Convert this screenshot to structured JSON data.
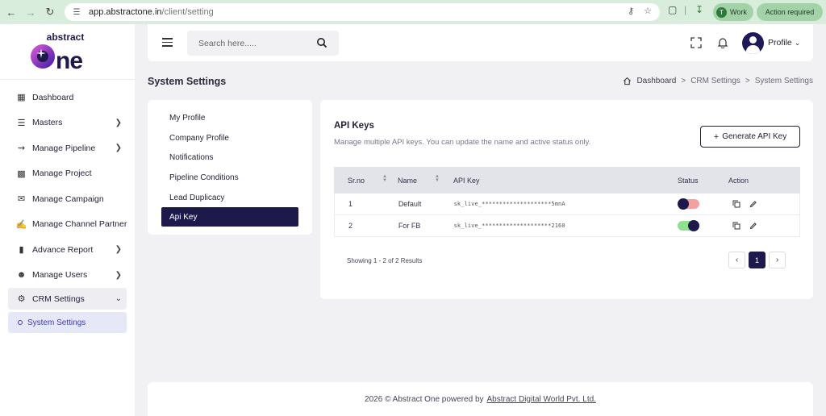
{
  "browser": {
    "url_host": "app.abstractone.in",
    "url_path": "/client/setting",
    "work_label": "Work",
    "work_initial": "T",
    "action_label": "Action required"
  },
  "sidebar": {
    "logo_top": "abstract",
    "logo_main": "One",
    "items": [
      {
        "label": "Dashboard",
        "icon": "dashboard-icon"
      },
      {
        "label": "Masters",
        "icon": "list-icon"
      },
      {
        "label": "Manage Pipeline",
        "icon": "pipeline-icon"
      },
      {
        "label": "Manage Project",
        "icon": "building-icon"
      },
      {
        "label": "Manage Campaign",
        "icon": "megaphone-icon"
      },
      {
        "label": "Manage Channel Partner",
        "icon": "handshake-icon"
      },
      {
        "label": "Advance Report",
        "icon": "bar-chart-icon"
      },
      {
        "label": "Manage Users",
        "icon": "users-icon"
      },
      {
        "label": "CRM Settings",
        "icon": "gear-icon"
      }
    ],
    "sub_active": "System Settings"
  },
  "header": {
    "search_placeholder": "Search here.....",
    "profile_label": "Profile"
  },
  "page": {
    "title": "System Settings",
    "breadcrumb": [
      "Dashboard",
      "CRM Settings",
      "System Settings"
    ],
    "breadcrumb_sep": ">"
  },
  "settings_nav": [
    "My Profile",
    "Company Profile",
    "Notifications",
    "Pipeline Conditions",
    "Lead Duplicacy",
    "Api Key"
  ],
  "api": {
    "title": "API Keys",
    "subtitle": "Manage multiple API keys. You can update the name and active status only.",
    "generate_label": "Generate API Key",
    "columns": [
      "Sr.no",
      "Name",
      "API Key",
      "Status",
      "Action"
    ],
    "rows": [
      {
        "sr": "1",
        "name": "Default",
        "key": "sk_live_********************5mnA",
        "status": "inactive"
      },
      {
        "sr": "2",
        "name": "For FB",
        "key": "sk_live_********************2160",
        "status": "active"
      }
    ],
    "showing": "Showing 1 - 2 of 2 Results",
    "current_page": "1"
  },
  "footer": {
    "text": "2026 © Abstract One powered by",
    "link": "Abstract Digital World Pvt. Ltd."
  },
  "colors": {
    "brand": "#1d1a4b",
    "accent_purple": "#6b2fd6",
    "toggle_on": "#8fe08f",
    "toggle_off": "#f2a1a1"
  }
}
